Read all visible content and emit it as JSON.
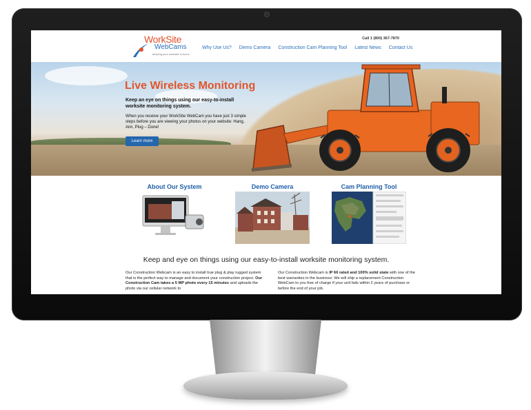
{
  "header": {
    "logo_line1": "WorkSite",
    "logo_line2": "WebCams",
    "logo_tagline": "keeping your worksite in focus",
    "phone": "Call 1 (800) 367-7870",
    "nav": [
      "Why Use Us?",
      "Demo Camera",
      "Construction Cam Planning Tool",
      "Latest News",
      "Contact Us"
    ]
  },
  "hero": {
    "title": "Live Wireless Monitoring",
    "subtitle": "Keep an eye on things using our easy-to-install worksite monitoring system.",
    "body": "When you receive your WorkSite WebCam you have just 3 simple steps before you are viewing your photos on your website: Hang, Aim, Plug – Done!",
    "button": "Learn more"
  },
  "features": [
    {
      "title": "About Our System"
    },
    {
      "title": "Demo Camera"
    },
    {
      "title": "Cam Planning Tool"
    }
  ],
  "tagline": "Keep and eye on things using our easy-to-install worksite monitoring system.",
  "columns": {
    "left_a": "Our Construction Webcam is an easy to install true plug & play rugged system that is the perfect way to manage and document your construction project. ",
    "left_b": "Our Construction Cam takes a 5 MP photo every 15 minutes",
    "left_c": " and uploads the photo via our cellular network to",
    "right_a": "Our Construction Webcam is ",
    "right_b": "IP 66 rated and 100% solid state",
    "right_c": " with one of the best warranties in the business: We will ship a replacement Construction WebCam to you free of charge if your unit fails within 2 years of purchase or before the end of your job."
  },
  "colors": {
    "accent_orange": "#e0552a",
    "link_blue": "#2a6fb8",
    "button_blue": "#2566ad",
    "bezel": "#111111"
  }
}
